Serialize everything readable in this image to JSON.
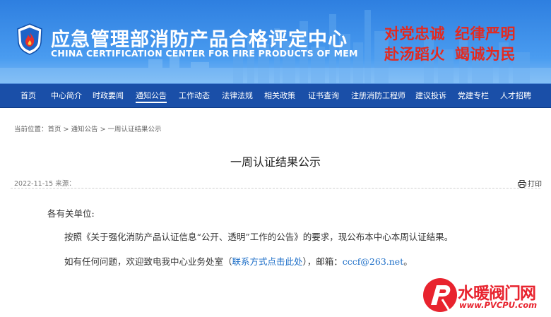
{
  "header": {
    "title_cn": "应急管理部消防产品合格评定中心",
    "title_en": "CHINA CERTIFICATION CENTER FOR FIRE PRODUCTS OF MEM",
    "slogans": [
      [
        "对党忠诚",
        "纪律严明"
      ],
      [
        "赴汤蹈火",
        "竭诚为民"
      ]
    ],
    "logo_icon": "fire-emblem-icon",
    "banner_color": "#2e7fe0",
    "slogan_color": "#e32a20"
  },
  "nav": {
    "items": [
      "首页",
      "中心简介",
      "时政要闻",
      "通知公告",
      "工作动态",
      "法律法规",
      "相关政策",
      "证书查询",
      "注册消防工程师",
      "建议投诉",
      "党建专栏",
      "人才招聘"
    ],
    "active": "通知公告",
    "color": "#1a4fa8"
  },
  "breadcrumb": {
    "label": "当前位置：",
    "items": [
      "首页",
      "通知公告",
      "一周认证结果公示"
    ],
    "sep": " > "
  },
  "article": {
    "title": "一周认证结果公示",
    "date": "2022-11-15",
    "source_label": "来源：",
    "print_label": "打印",
    "salutation": "各有关单位:",
    "para1": "按照《关于强化消防产品认证信息“公开、透明”工作的公告》的要求，现公布本中心本周认证结果。",
    "para2_prefix": "如有任何问题，欢迎致电我中心业务处室（",
    "para2_link": "联系方式点击此处",
    "para2_mid": "），邮箱：",
    "para2_email": "cccf@263.net",
    "para2_end": "。"
  },
  "watermark": {
    "text": "水暖阀门网",
    "url": "www.PVCPU.com",
    "color": "#e8232e"
  }
}
